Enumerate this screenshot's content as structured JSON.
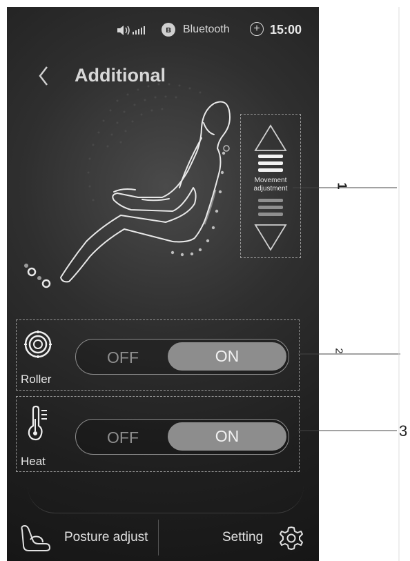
{
  "status_bar": {
    "bluetooth_label": "Bluetooth",
    "time": "15:00"
  },
  "header": {
    "title": "Additional"
  },
  "movement": {
    "label_line1": "Movement",
    "label_line2": "adjustment"
  },
  "roller": {
    "label": "Roller",
    "off_label": "OFF",
    "on_label": "ON"
  },
  "heat": {
    "label": "Heat",
    "off_label": "OFF",
    "on_label": "ON"
  },
  "bottom_nav": {
    "posture_label": "Posture adjust",
    "setting_label": "Setting"
  },
  "callouts": {
    "one": "1",
    "two": "2",
    "three": "3"
  }
}
